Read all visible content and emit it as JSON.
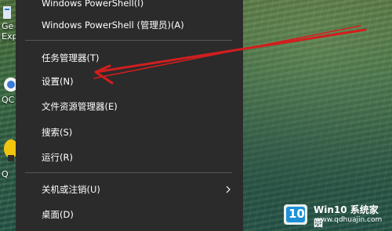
{
  "menu": {
    "items": [
      {
        "label": "Windows PowerShell(I)"
      },
      {
        "label": "Windows PowerShell (管理员)(A)"
      },
      {
        "label": "任务管理器(T)"
      },
      {
        "label": "设置(N)"
      },
      {
        "label": "文件资源管理器(E)"
      },
      {
        "label": "搜索(S)"
      },
      {
        "label": "运行(R)"
      },
      {
        "label": "关机或注销(U)"
      },
      {
        "label": "桌面(D)"
      }
    ]
  },
  "desktop": {
    "labels": [
      "Ge",
      "Exp",
      "QC",
      "Q"
    ]
  },
  "watermark": {
    "brand": "Win10 系统家园",
    "url": "www.qdhuajin.com",
    "badge": "10"
  },
  "colors": {
    "menu_bg": "#2b2b2b",
    "arrow": "#d21e1e",
    "badge_accent": "#1e90d8"
  }
}
